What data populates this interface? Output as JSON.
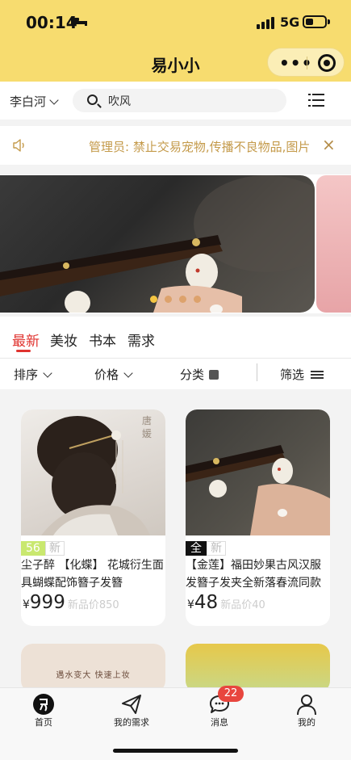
{
  "status_bar": {
    "time": "00:14",
    "network": "5G",
    "battery_percent": 40
  },
  "header": {
    "title": "易小小",
    "more_label": "•••"
  },
  "location": {
    "city": "李白河"
  },
  "search": {
    "value": "吹风"
  },
  "notice": {
    "text": "管理员: 禁止交易宠物,传播不良物品,图片",
    "close_label": "×"
  },
  "banner": {
    "slide_count": 4,
    "active_index": 0
  },
  "tabs": [
    {
      "label": "最新",
      "active": true
    },
    {
      "label": "美妆",
      "active": false
    },
    {
      "label": "书本",
      "active": false
    },
    {
      "label": "需求",
      "active": false
    }
  ],
  "filters": {
    "sort": "排序",
    "price": "价格",
    "category": "分类",
    "filter": "筛选"
  },
  "products": [
    {
      "badge_value": "56",
      "badge_value_color": "#c9e86f",
      "badge_tag": "新",
      "title": "尘子醉 【化蝶】 花城衍生面具蝴蝶配饰簪子发簪",
      "currency": "¥",
      "price": "999",
      "original_price": "新品价850",
      "image_watermark": "唐\n媛"
    },
    {
      "badge_value": "全",
      "badge_value_color": "#111111",
      "badge_tag": "新",
      "title": "【金莲】福田妙果古风汉服发簪子发夹全新落春流同款",
      "currency": "¥",
      "price": "48",
      "original_price": "新品价40"
    },
    {
      "image_text": "遇水变大 快速上妆"
    },
    {
      "image_text": ""
    }
  ],
  "tabbar": {
    "items": [
      {
        "label": "首页",
        "icon": "home-logo-icon"
      },
      {
        "label": "我的需求",
        "icon": "paper-plane-icon"
      },
      {
        "label": "消息",
        "icon": "chat-bubble-icon",
        "badge": "22"
      },
      {
        "label": "我的",
        "icon": "person-icon"
      }
    ]
  },
  "colors": {
    "accent_yellow": "#f7dc6f",
    "active_red": "#e0332f",
    "notice_gold": "#c49a4a"
  }
}
